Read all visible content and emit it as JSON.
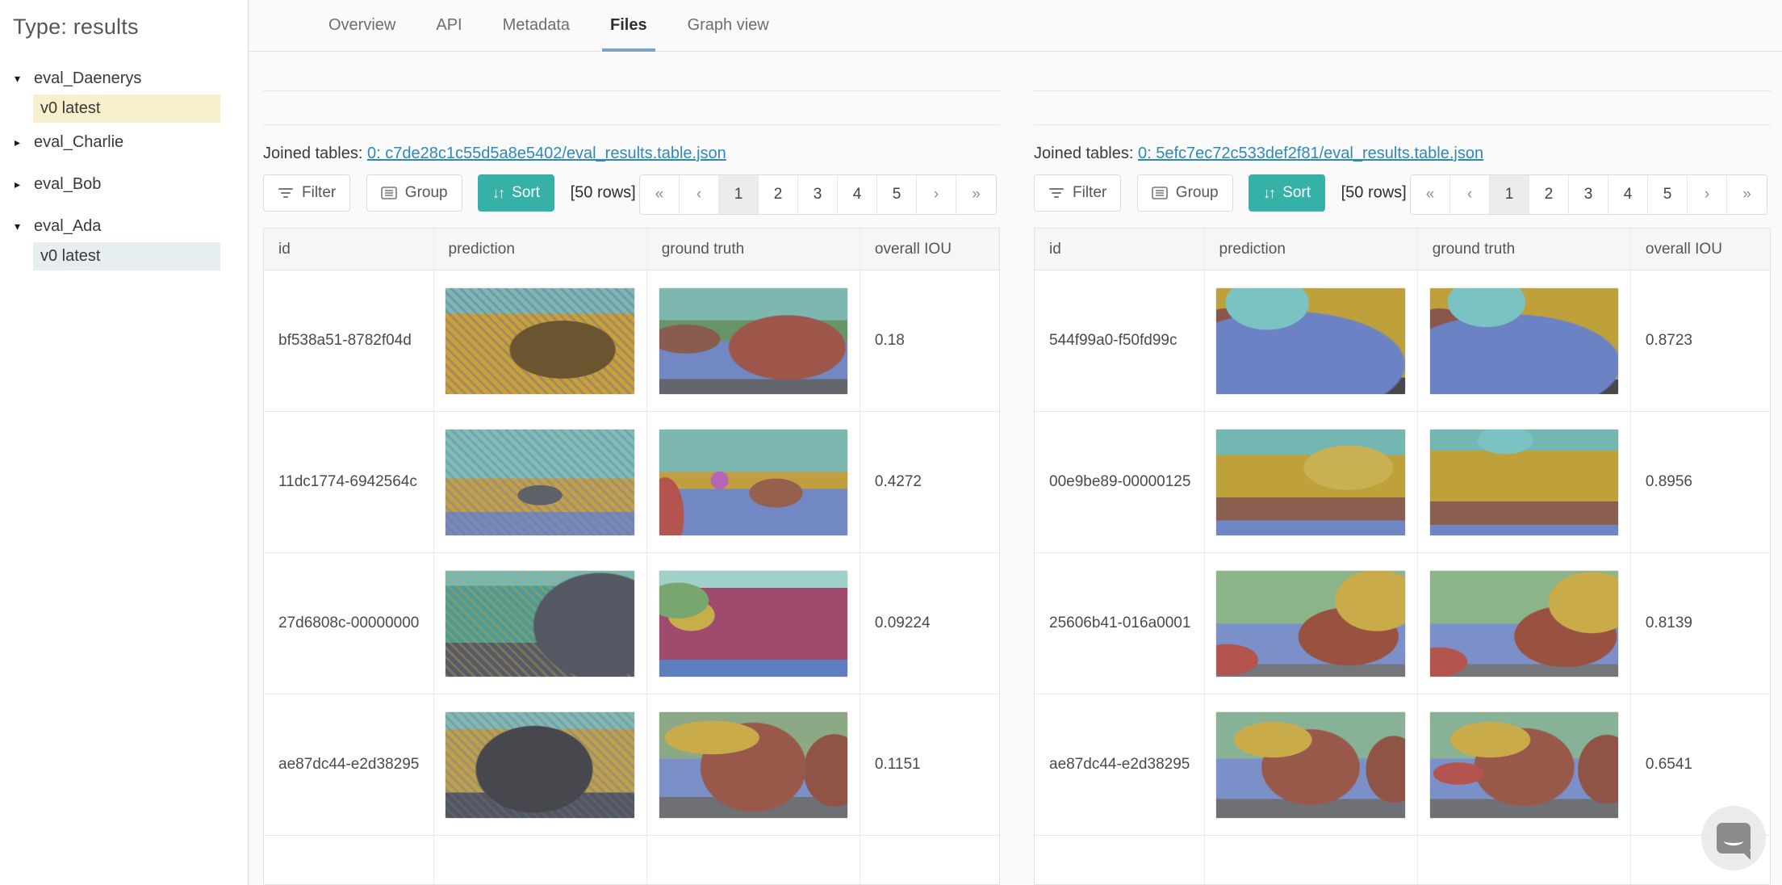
{
  "sidebar": {
    "title": "Type: results",
    "items": [
      {
        "label": "eval_Daenerys",
        "type": "parent",
        "expanded": true
      },
      {
        "label": "v0 latest",
        "type": "child",
        "highlight": "yellow"
      },
      {
        "label": "eval_Charlie",
        "type": "parent",
        "expanded": false
      },
      {
        "label": "eval_Bob",
        "type": "parent",
        "expanded": false
      },
      {
        "label": "eval_Ada",
        "type": "parent",
        "expanded": true
      },
      {
        "label": "v0 latest",
        "type": "child",
        "highlight": "blue"
      }
    ]
  },
  "tabs": [
    {
      "label": "Overview",
      "active": false
    },
    {
      "label": "API",
      "active": false
    },
    {
      "label": "Metadata",
      "active": false
    },
    {
      "label": "Files",
      "active": true
    },
    {
      "label": "Graph view",
      "active": false
    }
  ],
  "icons": {
    "filter": "filter-lines",
    "group": "list-box",
    "sort": "↓↑",
    "caret_expanded": "▾",
    "caret_collapsed": "▸",
    "chat": "speech-bubble-smile"
  },
  "colors": {
    "accent_teal": "#35b1a8",
    "link_blue": "#2d89ba",
    "tab_underline": "#7ba4c2",
    "highlight_yellow": "#f8efcd",
    "highlight_blue": "#e7eef2"
  },
  "panels": [
    {
      "joined_label": "Joined tables:",
      "joined_link": "0: c7de28c1c55d5a8e5402/eval_results.table.json",
      "toolbar": {
        "filter": "Filter",
        "group": "Group",
        "sort": "Sort",
        "rows_info": "[50 rows]"
      },
      "pagination": [
        "«",
        "‹",
        "1",
        "2",
        "3",
        "4",
        "5",
        "›",
        "»"
      ],
      "active_page": "1",
      "columns": [
        "id",
        "prediction",
        "ground truth",
        "overall IOU"
      ],
      "rows": [
        {
          "id": "bf538a51-8782f04d",
          "iou": "0.18",
          "pred": {
            "bands": [
              [
                "#7cb8af",
                24
              ],
              [
                "#c9a03a",
                100
              ]
            ],
            "blobs": [
              [
                "#6b5531",
                62,
                58,
                95,
                52
              ]
            ],
            "noise": "#5560a8"
          },
          "gt": {
            "bands": [
              [
                "#7cb8af",
                30
              ],
              [
                "#679468",
                50
              ],
              [
                "#7288c4",
                86
              ],
              [
                "#63666d",
                100
              ]
            ],
            "blobs": [
              [
                "#9e564b",
                68,
                56,
                105,
                58
              ],
              [
                "#8a5c50",
                14,
                48,
                62,
                26
              ]
            ]
          }
        },
        {
          "id": "11dc1774-6942564c",
          "iou": "0.4272",
          "pred": {
            "bands": [
              [
                "#7fbcb2",
                46
              ],
              [
                "#c2a04b",
                78
              ],
              [
                "#7a88b4",
                100
              ]
            ],
            "blobs": [
              [
                "#5d6168",
                50,
                62,
                40,
                18
              ]
            ],
            "noise": "#5e74b0"
          },
          "gt": {
            "bands": [
              [
                "#7cb8af",
                40
              ],
              [
                "#c19e3f",
                56
              ],
              [
                "#7288c4",
                100
              ]
            ],
            "blobs": [
              [
                "#b3544e",
                3,
                82,
                34,
                70
              ],
              [
                "#96604f",
                62,
                60,
                48,
                26
              ],
              [
                "#b665b5",
                32,
                48,
                16,
                16
              ]
            ]
          }
        },
        {
          "id": "27d6808c-00000000",
          "iou": "0.09224",
          "pred": {
            "bands": [
              [
                "#74b7b8",
                14
              ],
              [
                "#4f9a92",
                68
              ],
              [
                "#565a66",
                100
              ]
            ],
            "blobs": [
              [
                "#545862",
                82,
                52,
                120,
                95
              ]
            ],
            "noise": "#c9a83f"
          },
          "gt": {
            "bands": [
              [
                "#9fd0c9",
                16
              ],
              [
                "#a04a6e",
                84
              ],
              [
                "#5f7ec0",
                100
              ]
            ],
            "blobs": [
              [
                "#79a56e",
                10,
                28,
                55,
                32
              ],
              [
                "#c7ae49",
                17,
                42,
                42,
                28
              ]
            ]
          }
        },
        {
          "id": "ae87dc44-e2d38295",
          "iou": "0.1151",
          "pred": {
            "bands": [
              [
                "#83b8ae",
                16
              ],
              [
                "#bd9f4c",
                76
              ],
              [
                "#54565c",
                100
              ]
            ],
            "blobs": [
              [
                "#47484e",
                47,
                54,
                105,
                78
              ]
            ],
            "noise": "#5e74b0"
          },
          "gt": {
            "bands": [
              [
                "#8ca986",
                44
              ],
              [
                "#7b8fc9",
                80
              ],
              [
                "#6e7076",
                100
              ]
            ],
            "blobs": [
              [
                "#c9ab4a",
                28,
                24,
                85,
                30
              ],
              [
                "#99594a",
                50,
                52,
                95,
                80
              ],
              [
                "#8f5446",
                93,
                55,
                55,
                65
              ]
            ]
          }
        }
      ]
    },
    {
      "joined_label": "Joined tables:",
      "joined_link": "0: 5efc7ec72c533def2f81/eval_results.table.json",
      "toolbar": {
        "filter": "Filter",
        "group": "Group",
        "sort": "Sort",
        "rows_info": "[50 rows]"
      },
      "pagination": [
        "«",
        "‹",
        "1",
        "2",
        "3",
        "4",
        "5",
        "›",
        "»"
      ],
      "active_page": "1",
      "columns": [
        "id",
        "prediction",
        "ground truth",
        "overall IOU"
      ],
      "rows": [
        {
          "id": "544f99a0-f50fd99c",
          "iou": "0.8723",
          "pred": {
            "bands": [
              [
                "#bfa13c",
                100
              ]
            ],
            "blobs": [
              [
                "#7bc2c2",
                27,
                14,
                75,
                48
              ],
              [
                "#6b82c4",
                38,
                72,
                210,
                95
              ],
              [
                "#8a564a",
                5,
                48,
                60,
                55
              ],
              [
                "#46484c",
                50,
                97,
                320,
                28
              ]
            ]
          },
          "gt": {
            "bands": [
              [
                "#bfa13c",
                100
              ]
            ],
            "blobs": [
              [
                "#7bc2c2",
                30,
                13,
                70,
                45
              ],
              [
                "#6b82c4",
                42,
                72,
                200,
                90
              ],
              [
                "#8a564a",
                5,
                48,
                60,
                55
              ],
              [
                "#9c4f7a",
                37,
                44,
                20,
                15
              ],
              [
                "#46484c",
                45,
                97,
                300,
                26
              ]
            ]
          }
        },
        {
          "id": "00e9be89-00000125",
          "iou": "0.8956",
          "pred": {
            "bands": [
              [
                "#74b6b2",
                24
              ],
              [
                "#bfa13c",
                64
              ],
              [
                "#8a5f4f",
                86
              ],
              [
                "#6f86c4",
                100
              ]
            ],
            "blobs": [
              [
                "#c9b053",
                70,
                36,
                80,
                40
              ]
            ]
          },
          "gt": {
            "bands": [
              [
                "#74b6b2",
                20
              ],
              [
                "#bfa13c",
                68
              ],
              [
                "#8a5f4f",
                90
              ],
              [
                "#6f86c4",
                100
              ]
            ],
            "blobs": [
              [
                "#7bc2c2",
                40,
                10,
                50,
                25
              ]
            ]
          }
        },
        {
          "id": "25606b41-016a0001",
          "iou": "0.8139",
          "pred": {
            "bands": [
              [
                "#8bb489",
                50
              ],
              [
                "#7b8fc9",
                88
              ],
              [
                "#74767c",
                100
              ]
            ],
            "blobs": [
              [
                "#c9ab4a",
                85,
                28,
                75,
                55
              ],
              [
                "#98523f",
                70,
                62,
                90,
                52
              ],
              [
                "#b3544e",
                6,
                84,
                55,
                28
              ]
            ]
          },
          "gt": {
            "bands": [
              [
                "#8bb489",
                50
              ],
              [
                "#7b8fc9",
                88
              ],
              [
                "#74767c",
                100
              ]
            ],
            "blobs": [
              [
                "#c9ab4a",
                86,
                30,
                78,
                55
              ],
              [
                "#98523f",
                72,
                62,
                92,
                55
              ],
              [
                "#b3544e",
                5,
                86,
                50,
                26
              ]
            ]
          }
        },
        {
          "id": "ae87dc44-e2d38295",
          "iou": "0.6541",
          "pred": {
            "bands": [
              [
                "#88b297",
                44
              ],
              [
                "#7b8fc9",
                82
              ],
              [
                "#6e7076",
                100
              ]
            ],
            "blobs": [
              [
                "#c9ab4a",
                30,
                26,
                70,
                32
              ],
              [
                "#99594a",
                50,
                52,
                88,
                68
              ],
              [
                "#8f5446",
                94,
                54,
                50,
                60
              ]
            ]
          },
          "gt": {
            "bands": [
              [
                "#88b297",
                44
              ],
              [
                "#7b8fc9",
                82
              ],
              [
                "#6e7076",
                100
              ]
            ],
            "blobs": [
              [
                "#c9ab4a",
                32,
                26,
                72,
                32
              ],
              [
                "#b3544e",
                15,
                58,
                45,
                20
              ],
              [
                "#99594a",
                50,
                52,
                90,
                70
              ],
              [
                "#8f5446",
                94,
                54,
                52,
                62
              ]
            ]
          }
        }
      ]
    }
  ]
}
